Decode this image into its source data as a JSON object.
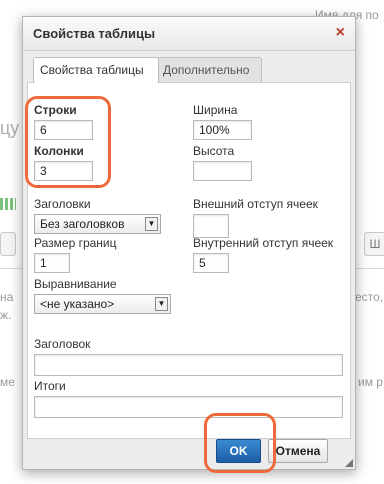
{
  "background": {
    "top_right_text": "Имя для по",
    "left_frag_1": "цу",
    "left_frag_2": "на",
    "left_frag_3": "ж.",
    "left_frag_4": "ме",
    "right_frag_1": "есто,",
    "right_frag_2": "им р",
    "right_btn_label": "Ш"
  },
  "dialog": {
    "title": "Свойства таблицы",
    "close_glyph": "×",
    "tabs": [
      {
        "label": "Свойства таблицы",
        "active": true
      },
      {
        "label": "Дополнительно",
        "active": false
      }
    ],
    "rows": {
      "label": "Строки",
      "value": "6"
    },
    "columns": {
      "label": "Колонки",
      "value": "3"
    },
    "width": {
      "label": "Ширина",
      "value": "100%"
    },
    "height": {
      "label": "Высота",
      "value": ""
    },
    "headers": {
      "label": "Заголовки",
      "selected": "Без заголовков"
    },
    "cell_spacing": {
      "label": "Внешний отступ ячеек",
      "value": ""
    },
    "border_size": {
      "label": "Размер границ",
      "value": "1"
    },
    "cell_padding": {
      "label": "Внутренний отступ ячеек",
      "value": "5"
    },
    "alignment": {
      "label": "Выравнивание",
      "selected": "<не указано>"
    },
    "caption": {
      "label": "Заголовок",
      "value": ""
    },
    "summary": {
      "label": "Итоги",
      "value": ""
    },
    "ok_label": "OK",
    "cancel_label": "Отмена",
    "accent_color": "#ee6a3a",
    "close_color": "#c0392b"
  }
}
